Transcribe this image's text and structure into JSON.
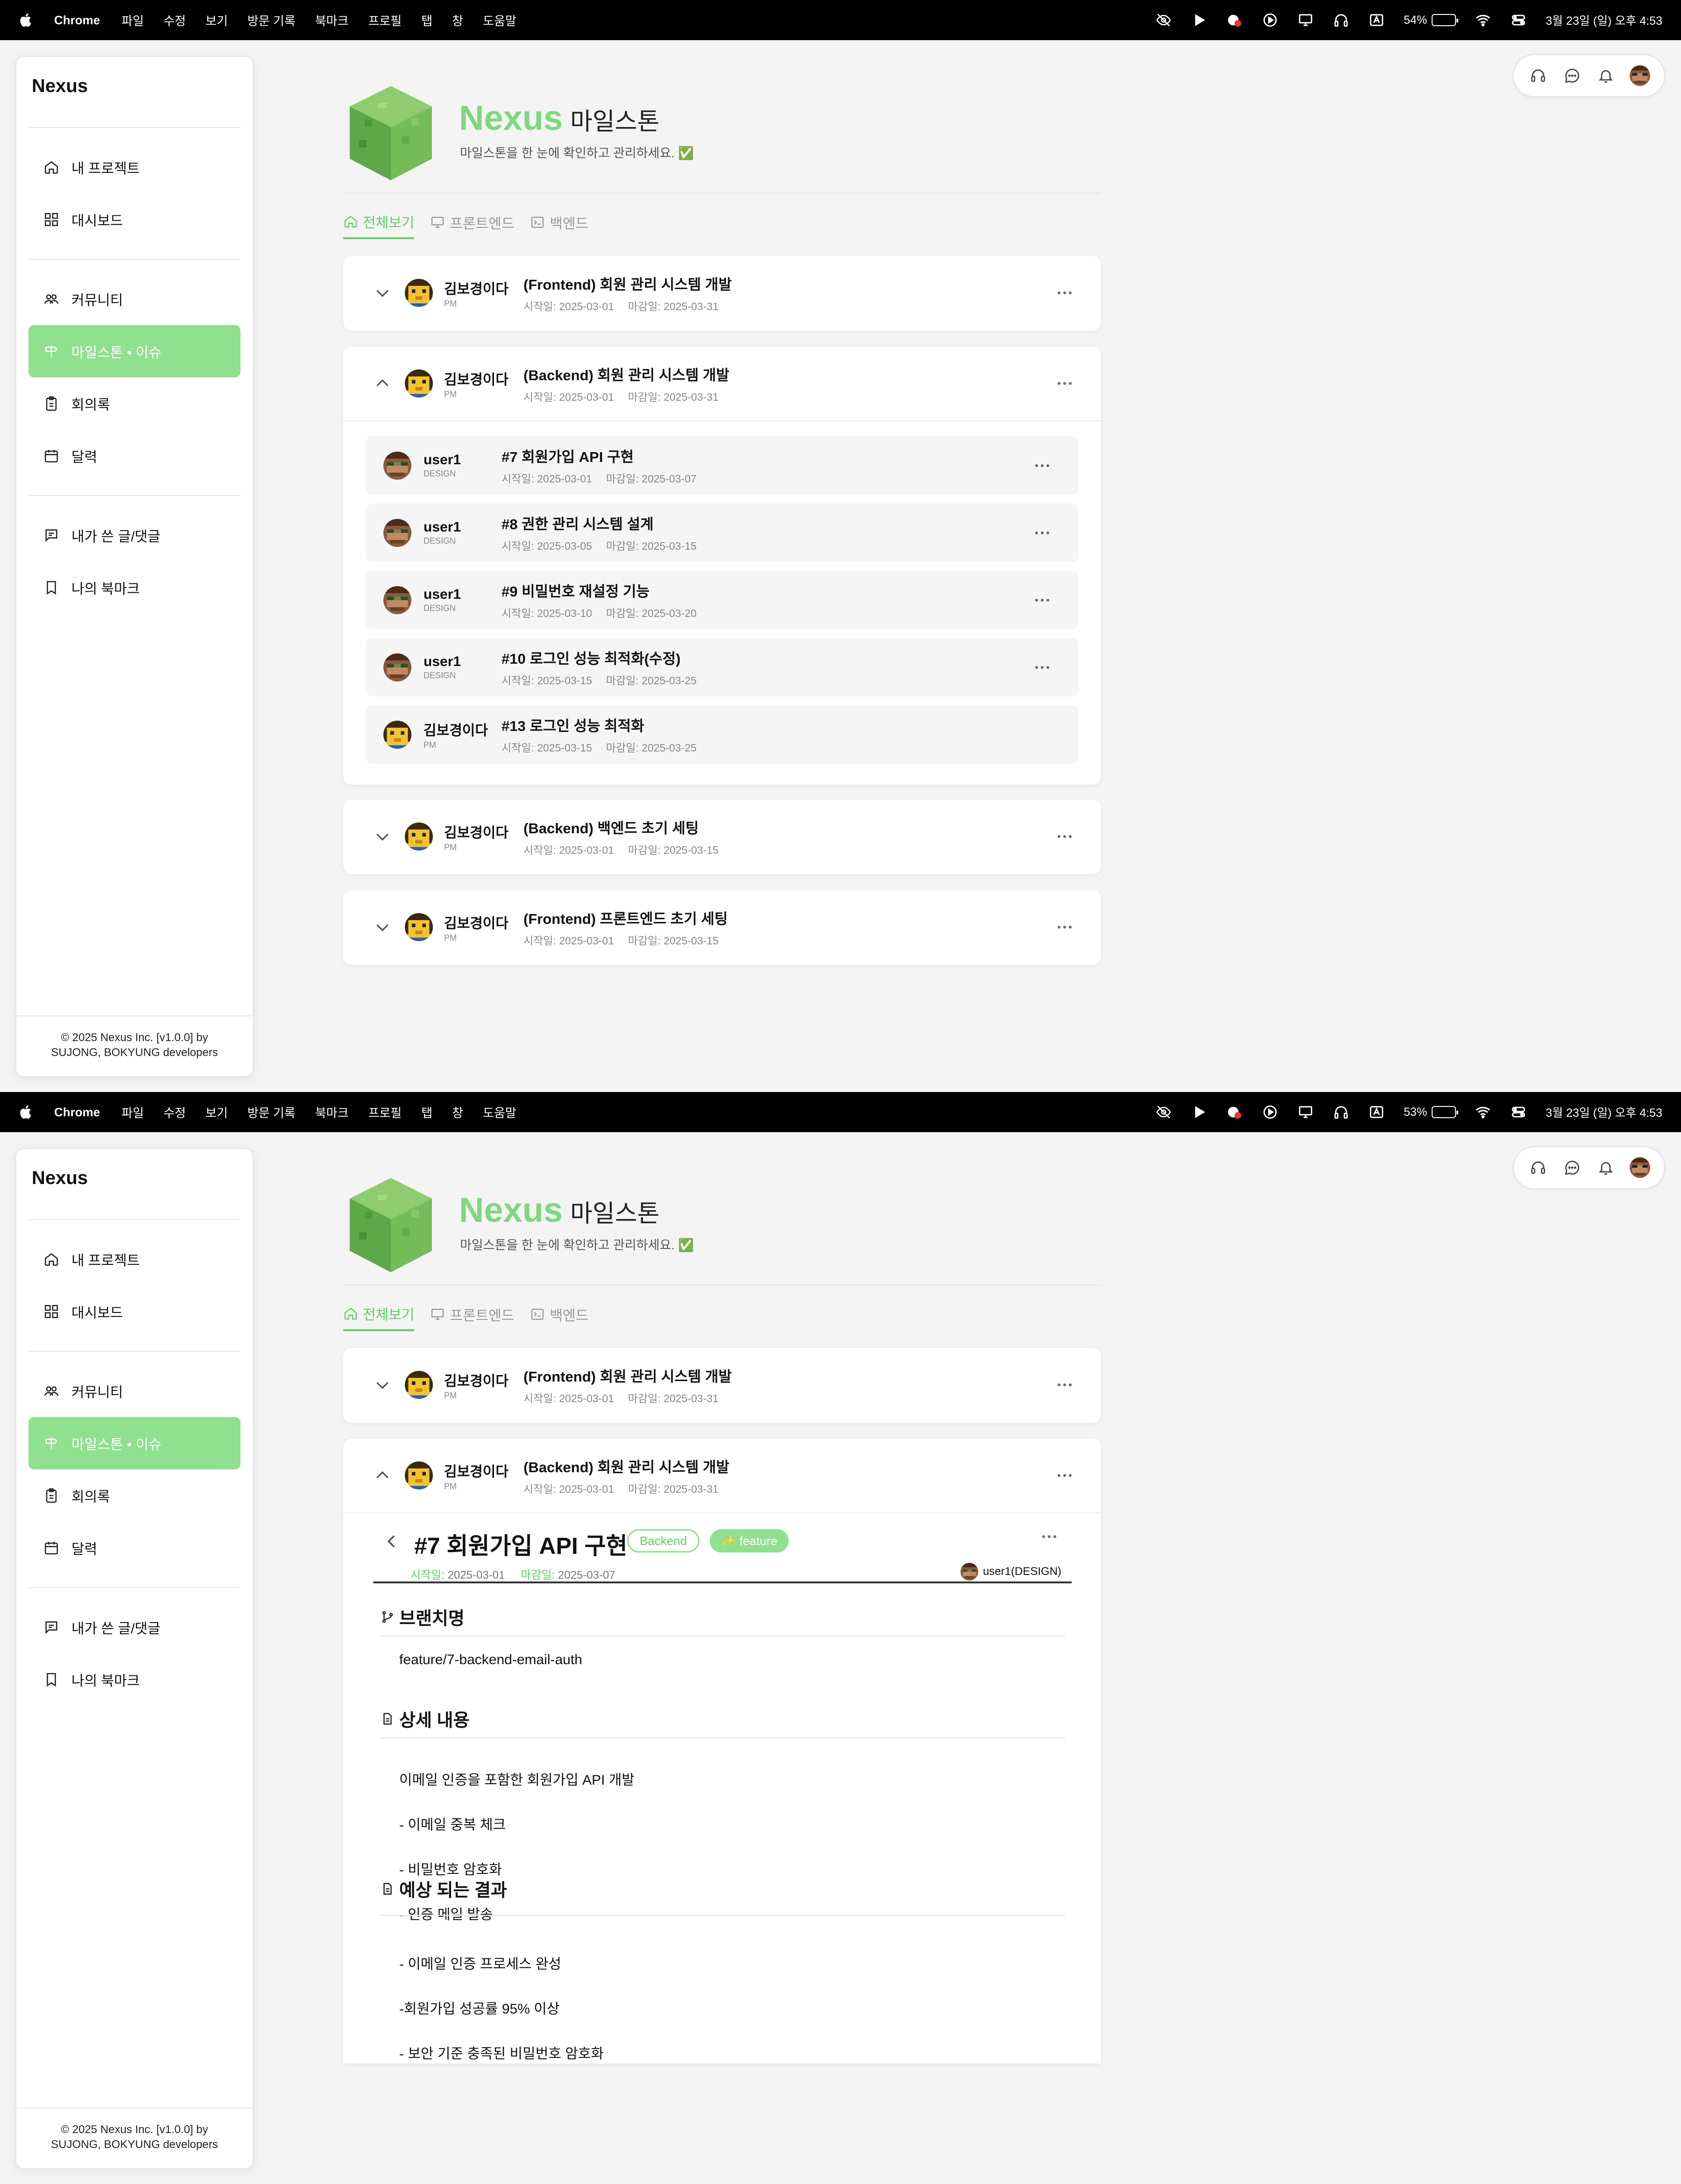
{
  "menubar": {
    "app": "Chrome",
    "items": [
      "파일",
      "수정",
      "보기",
      "방문 기록",
      "북마크",
      "프로필",
      "탭",
      "창",
      "도움말"
    ],
    "battery_1": "54%",
    "battery_1_level": 0.54,
    "battery_2": "53%",
    "battery_2_level": 0.53,
    "datetime": "3월 23일 (일) 오후 4:53"
  },
  "sidebar": {
    "logo": "Nexus",
    "items": [
      {
        "label": "내 프로젝트",
        "icon": "home-icon"
      },
      {
        "label": "대시보드",
        "icon": "grid-icon"
      },
      {
        "label": "커뮤니티",
        "icon": "people-icon"
      },
      {
        "label": "마일스톤 • 이슈",
        "icon": "signpost-icon"
      },
      {
        "label": "회의록",
        "icon": "clipboard-icon"
      },
      {
        "label": "달력",
        "icon": "calendar-icon"
      },
      {
        "label": "내가 쓴 글/댓글",
        "icon": "chat-icon"
      },
      {
        "label": "나의 북마크",
        "icon": "bookmark-icon"
      }
    ],
    "active_index": 3,
    "footer_line1": "© 2025 Nexus Inc. [v1.0.0] by",
    "footer_line2": "SUJONG, BOKYUNG developers"
  },
  "toolbar": {
    "icons": [
      "headset-icon",
      "chat-icon",
      "bell-icon",
      "user-avatar"
    ]
  },
  "header": {
    "brand": "Nexus",
    "title": "마일스톤",
    "subtitle": "마일스톤을 한 눈에 확인하고 관리하세요. ✅"
  },
  "tabs": [
    {
      "label": "전체보기",
      "active": true
    },
    {
      "label": "프론트엔드",
      "active": false
    },
    {
      "label": "백엔드",
      "active": false
    }
  ],
  "date_labels": {
    "start": "시작일:",
    "due": "마감일:"
  },
  "milestones": [
    {
      "owner": "김보경이다",
      "role": "PM",
      "title": "(Frontend) 회원 관리 시스템 개발",
      "start": "2025-03-01",
      "due": "2025-03-31",
      "expanded": false
    },
    {
      "owner": "김보경이다",
      "role": "PM",
      "title": "(Backend) 회원 관리 시스템 개발",
      "start": "2025-03-01",
      "due": "2025-03-31",
      "expanded": true
    },
    {
      "owner": "김보경이다",
      "role": "PM",
      "title": "(Backend) 백엔드 초기 세팅",
      "start": "2025-03-01",
      "due": "2025-03-15",
      "expanded": false
    },
    {
      "owner": "김보경이다",
      "role": "PM",
      "title": "(Frontend) 프론트엔드 초기 세팅",
      "start": "2025-03-01",
      "due": "2025-03-15",
      "expanded": false
    }
  ],
  "issues": [
    {
      "owner": "user1",
      "role": "DESIGN",
      "title": "#7 회원가입 API 구현",
      "start": "2025-03-01",
      "due": "2025-03-07",
      "menu": true
    },
    {
      "owner": "user1",
      "role": "DESIGN",
      "title": "#8 권한 관리 시스템 설계",
      "start": "2025-03-05",
      "due": "2025-03-15",
      "menu": true
    },
    {
      "owner": "user1",
      "role": "DESIGN",
      "title": "#9 비밀번호 재설정 기능",
      "start": "2025-03-10",
      "due": "2025-03-20",
      "menu": true
    },
    {
      "owner": "user1",
      "role": "DESIGN",
      "title": "#10 로그인 성능 최적화(수정)",
      "start": "2025-03-15",
      "due": "2025-03-25",
      "menu": true
    },
    {
      "owner": "김보경이다",
      "role": "PM",
      "title": "#13 로그인 성능 최적화",
      "start": "2025-03-15",
      "due": "2025-03-25",
      "menu": false
    }
  ],
  "issue_detail": {
    "title": "#7 회원가입 API 구현",
    "tag_outline": "Backend",
    "tag_solid": "✨ feature",
    "start": "2025-03-01",
    "due": "2025-03-07",
    "assignee": "user1(DESIGN)",
    "branch_heading": "브랜치명",
    "branch": "feature/7-backend-email-auth",
    "detail_heading": "상세 내용",
    "detail_lines": [
      "이메일 인증을 포함한 회원가입 API 개발",
      "- 이메일 중복 체크",
      "- 비밀번호 암호화",
      "- 인증 메일 발송"
    ],
    "result_heading": "예상 되는 결과",
    "result_lines": [
      "- 이메일 인증 프로세스 완성",
      "-회원가입 성공률 95% 이상",
      "- 보안 기준 충족된 비밀번호 암호화"
    ]
  },
  "colors": {
    "accent": "#8fe08f",
    "accent_text": "#5fcf5f",
    "brand": "#7fd77f"
  }
}
